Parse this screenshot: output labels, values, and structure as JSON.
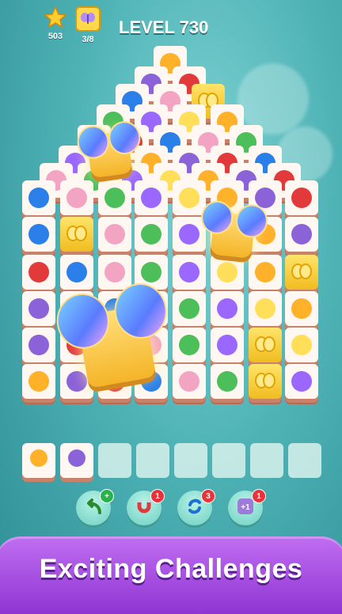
{
  "hud": {
    "stars_value": "503",
    "butterfly_value": "3/8",
    "level_title": "LEVEL 730",
    "icons": [
      "star-icon",
      "butterfly-icon"
    ]
  },
  "tools": [
    {
      "name": "undo-tool",
      "icon": "undo-arrow-icon",
      "badge": "+"
    },
    {
      "name": "magnet-tool",
      "icon": "magnet-icon",
      "badge": "1"
    },
    {
      "name": "shuffle-tool",
      "icon": "shuffle-icon",
      "badge": "3"
    },
    {
      "name": "extra-slot-tool",
      "icon": "plus-one-icon",
      "badge": "1"
    }
  ],
  "tray": {
    "capacity": 8,
    "filled": [
      "sunflower-cone",
      "violet-cone"
    ]
  },
  "banner": {
    "text": "Exciting Challenges"
  },
  "colors": {
    "accent_purple": "#9a42db",
    "tile_face": "#fff8f2",
    "tile_edge": "#c9826a",
    "gold_tile": "#f0bc20",
    "badge_red": "#e8333a"
  }
}
